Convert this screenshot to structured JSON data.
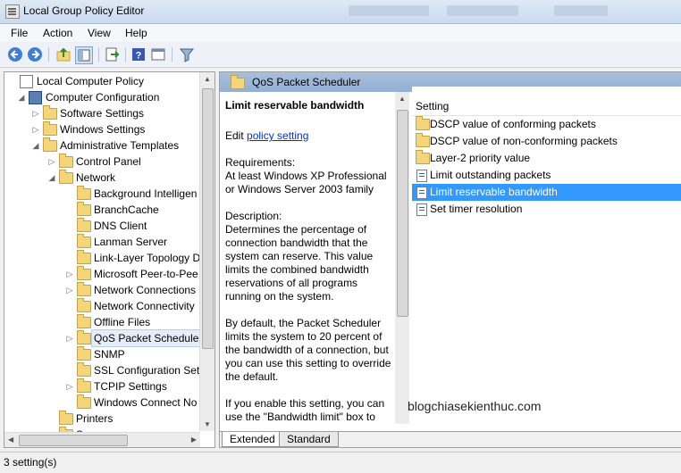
{
  "window": {
    "title": "Local Group Policy Editor",
    "blurred_tabs": [
      "Ponte Family",
      "Ponte Sizes",
      "Fortnalb"
    ]
  },
  "menu": [
    "File",
    "Action",
    "View",
    "Help"
  ],
  "tree": {
    "items": [
      {
        "label": "Local Computer Policy",
        "level": 0,
        "expander": "",
        "icon": "computer-policy-icon"
      },
      {
        "label": "Computer Configuration",
        "level": 1,
        "expander": "◢",
        "icon": "computer-icon"
      },
      {
        "label": "Software Settings",
        "level": 2,
        "expander": "▷",
        "icon": "folder-icon"
      },
      {
        "label": "Windows Settings",
        "level": 2,
        "expander": "▷",
        "icon": "folder-icon"
      },
      {
        "label": "Administrative Templates",
        "level": 2,
        "expander": "◢",
        "icon": "folder-icon"
      },
      {
        "label": "Control Panel",
        "level": 3,
        "expander": "▷",
        "icon": "folder-icon"
      },
      {
        "label": "Network",
        "level": 3,
        "expander": "◢",
        "icon": "folder-icon"
      },
      {
        "label": "Background Intelligen",
        "level": 4,
        "expander": "",
        "icon": "folder-icon"
      },
      {
        "label": "BranchCache",
        "level": 4,
        "expander": "",
        "icon": "folder-icon"
      },
      {
        "label": "DNS Client",
        "level": 4,
        "expander": "",
        "icon": "folder-icon"
      },
      {
        "label": "Lanman Server",
        "level": 4,
        "expander": "",
        "icon": "folder-icon"
      },
      {
        "label": "Link-Layer Topology D",
        "level": 4,
        "expander": "",
        "icon": "folder-icon"
      },
      {
        "label": "Microsoft Peer-to-Pee",
        "level": 4,
        "expander": "▷",
        "icon": "folder-icon"
      },
      {
        "label": "Network Connections",
        "level": 4,
        "expander": "▷",
        "icon": "folder-icon"
      },
      {
        "label": "Network Connectivity",
        "level": 4,
        "expander": "",
        "icon": "folder-icon"
      },
      {
        "label": "Offline Files",
        "level": 4,
        "expander": "",
        "icon": "folder-icon"
      },
      {
        "label": "QoS Packet Scheduler",
        "level": 4,
        "expander": "▷",
        "icon": "folder-icon",
        "selected": true
      },
      {
        "label": "SNMP",
        "level": 4,
        "expander": "",
        "icon": "folder-icon"
      },
      {
        "label": "SSL Configuration Sett",
        "level": 4,
        "expander": "",
        "icon": "folder-icon"
      },
      {
        "label": "TCPIP Settings",
        "level": 4,
        "expander": "▷",
        "icon": "folder-icon"
      },
      {
        "label": "Windows Connect No",
        "level": 4,
        "expander": "",
        "icon": "folder-icon"
      },
      {
        "label": "Printers",
        "level": 3,
        "expander": "",
        "icon": "folder-icon"
      },
      {
        "label": "S...",
        "level": 3,
        "expander": "",
        "icon": "folder-icon"
      }
    ]
  },
  "right": {
    "header": "QoS Packet Scheduler",
    "desc": {
      "title": "Limit reservable bandwidth",
      "edit_prefix": "Edit ",
      "edit_link": "policy setting",
      "requirements_label": "Requirements:",
      "requirements": "At least Windows XP Professional or Windows Server 2003 family",
      "description_label": "Description:",
      "description": "Determines the percentage of connection bandwidth that the system can reserve. This value limits the combined bandwidth reservations of all programs running on the system.",
      "default_text": "By default, the Packet Scheduler limits the system to 20 percent of the bandwidth of a connection, but you can use this setting to override the default.",
      "enable_text": "If you enable this setting, you can use the \"Bandwidth limit\" box to adjust the amount of bandwidth"
    },
    "column_header": "Setting",
    "settings": [
      {
        "label": "DSCP value of conforming packets",
        "icon": "folder-icon"
      },
      {
        "label": "DSCP value of non-conforming packets",
        "icon": "folder-icon"
      },
      {
        "label": "Layer-2 priority value",
        "icon": "folder-icon"
      },
      {
        "label": "Limit outstanding packets",
        "icon": "setting-icon"
      },
      {
        "label": "Limit reservable bandwidth",
        "icon": "setting-icon",
        "selected": true
      },
      {
        "label": "Set timer resolution",
        "icon": "setting-icon"
      }
    ],
    "watermark": "blogchiasekienthuc.com",
    "tabs": [
      "Extended",
      "Standard"
    ]
  },
  "status": "3 setting(s)"
}
